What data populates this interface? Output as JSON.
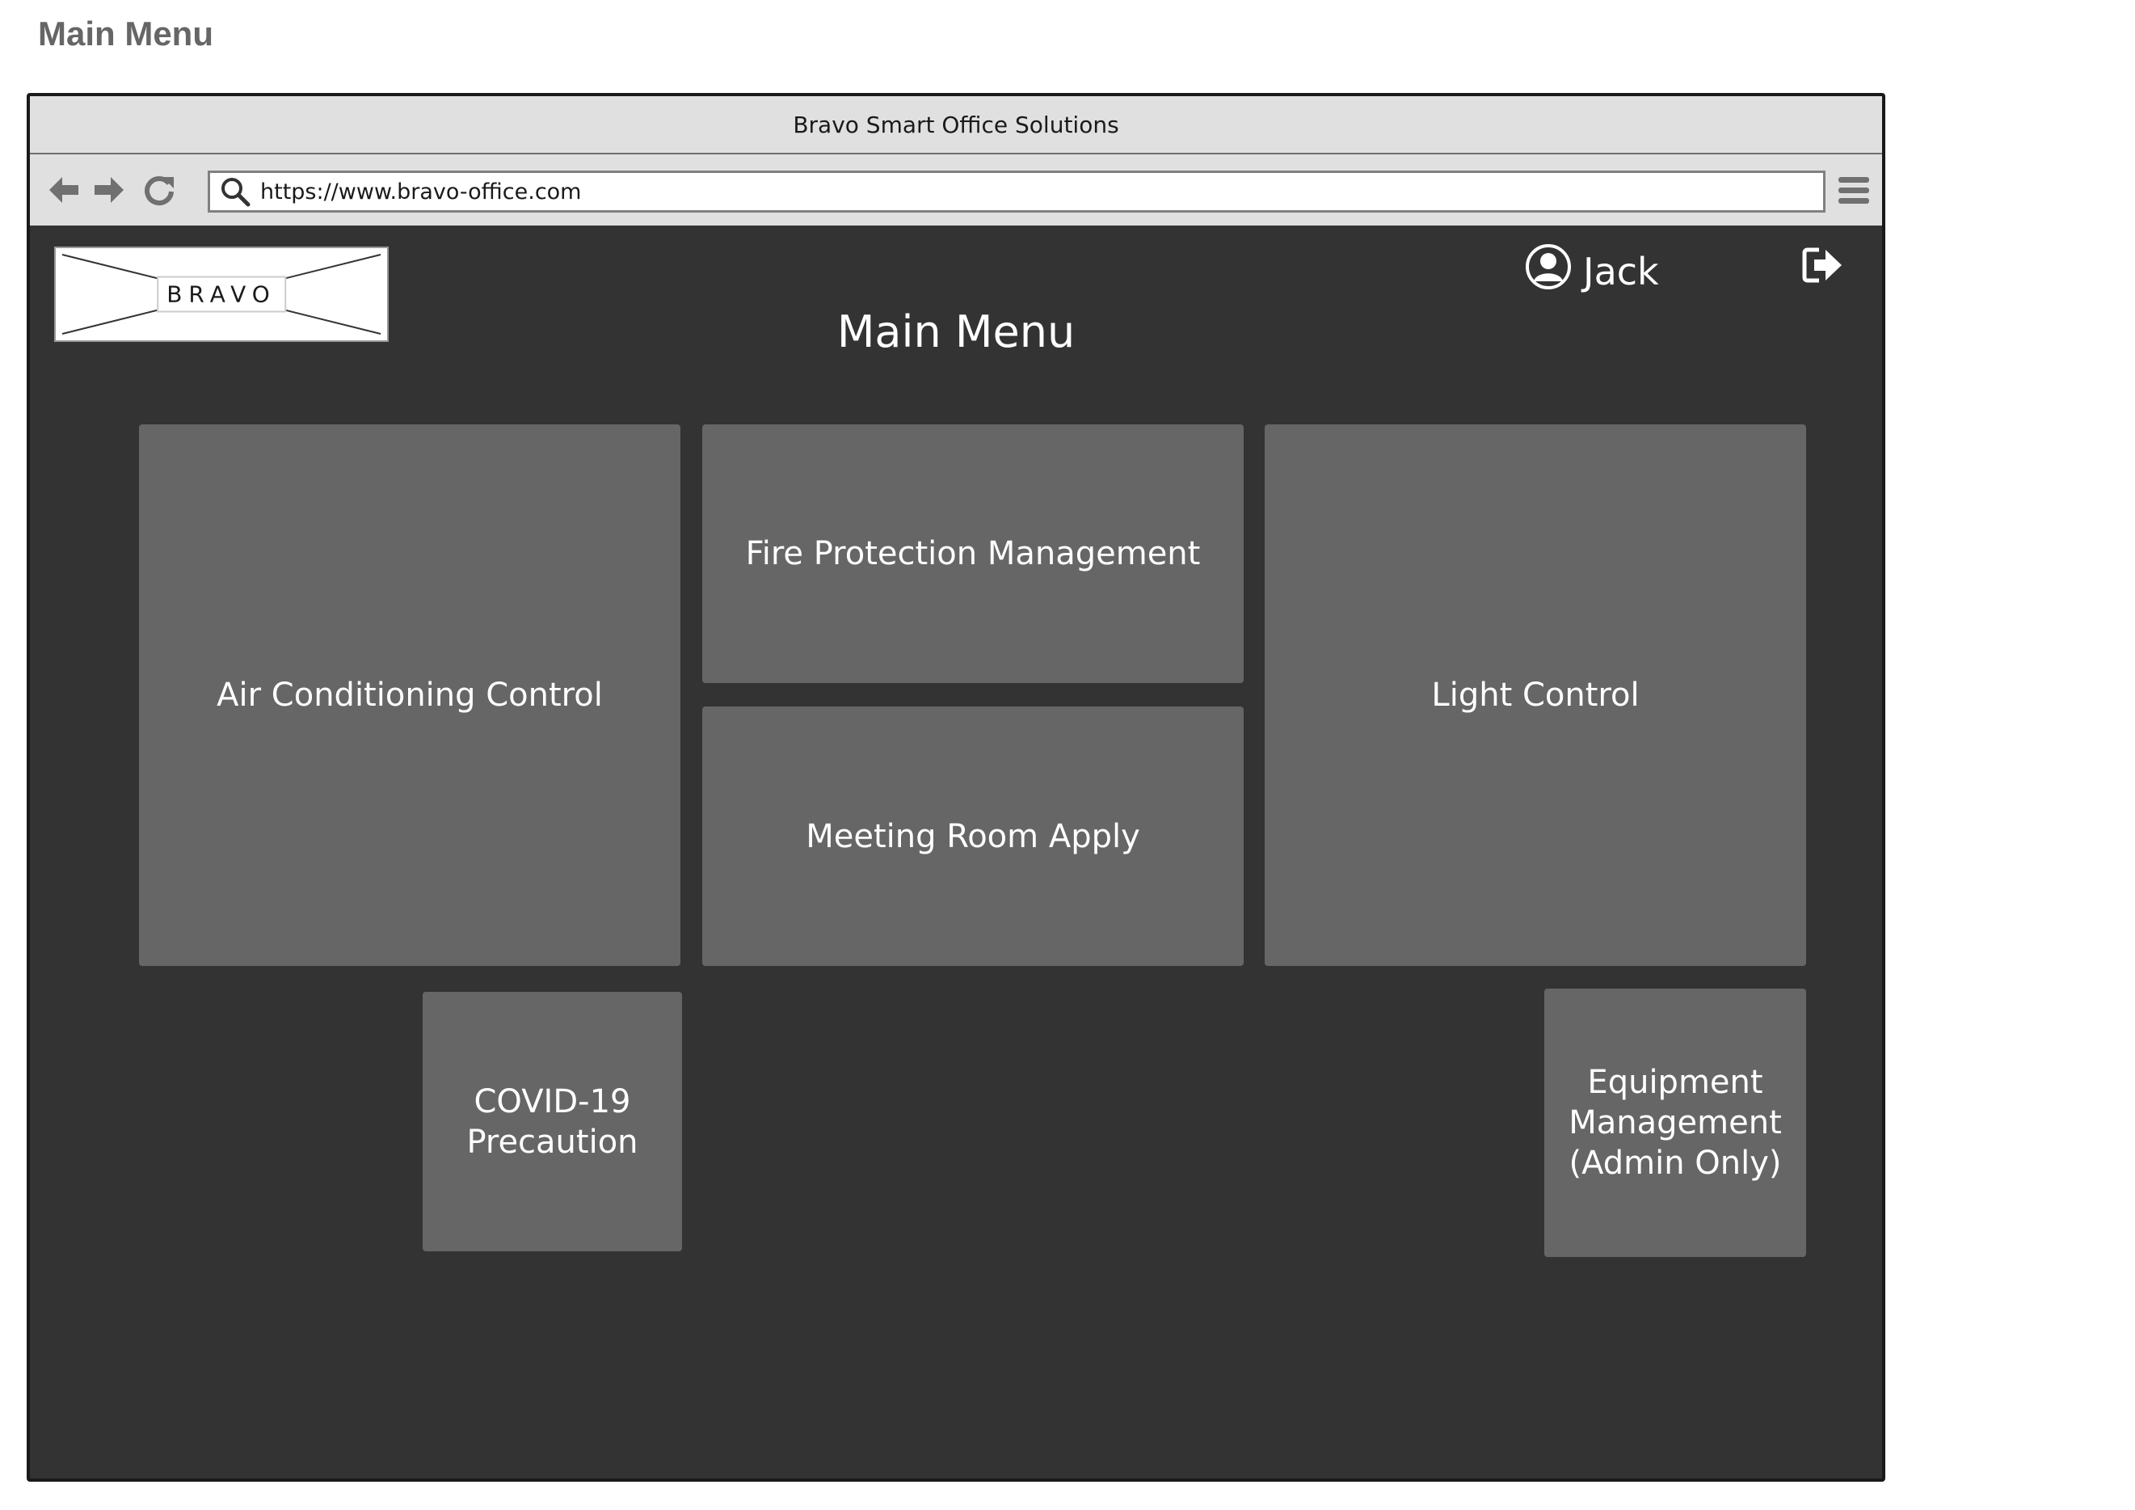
{
  "caption": "Main Menu",
  "window": {
    "title": "Bravo Smart Office Solutions",
    "url": "https://www.bravo-office.com"
  },
  "icons": {
    "back": "arrow-left-icon",
    "forward": "arrow-right-icon",
    "reload": "reload-icon",
    "search": "search-icon",
    "menu": "hamburger-menu-icon",
    "user": "user-circle-icon",
    "logout": "logout-icon"
  },
  "header": {
    "logo_text": "BRAVO",
    "user_name": "Jack",
    "title": "Main Menu"
  },
  "tiles": {
    "air_conditioning": "Air Conditioning Control",
    "fire_protection": "Fire Protection Management",
    "meeting_room": "Meeting Room Apply",
    "light_control": "Light Control",
    "covid": "COVID-19\nPrecaution",
    "equipment": "Equipment\nManagement\n(Admin Only)"
  },
  "colors": {
    "background": "#333333",
    "tile": "#666666",
    "chrome": "#e0e0e0"
  }
}
